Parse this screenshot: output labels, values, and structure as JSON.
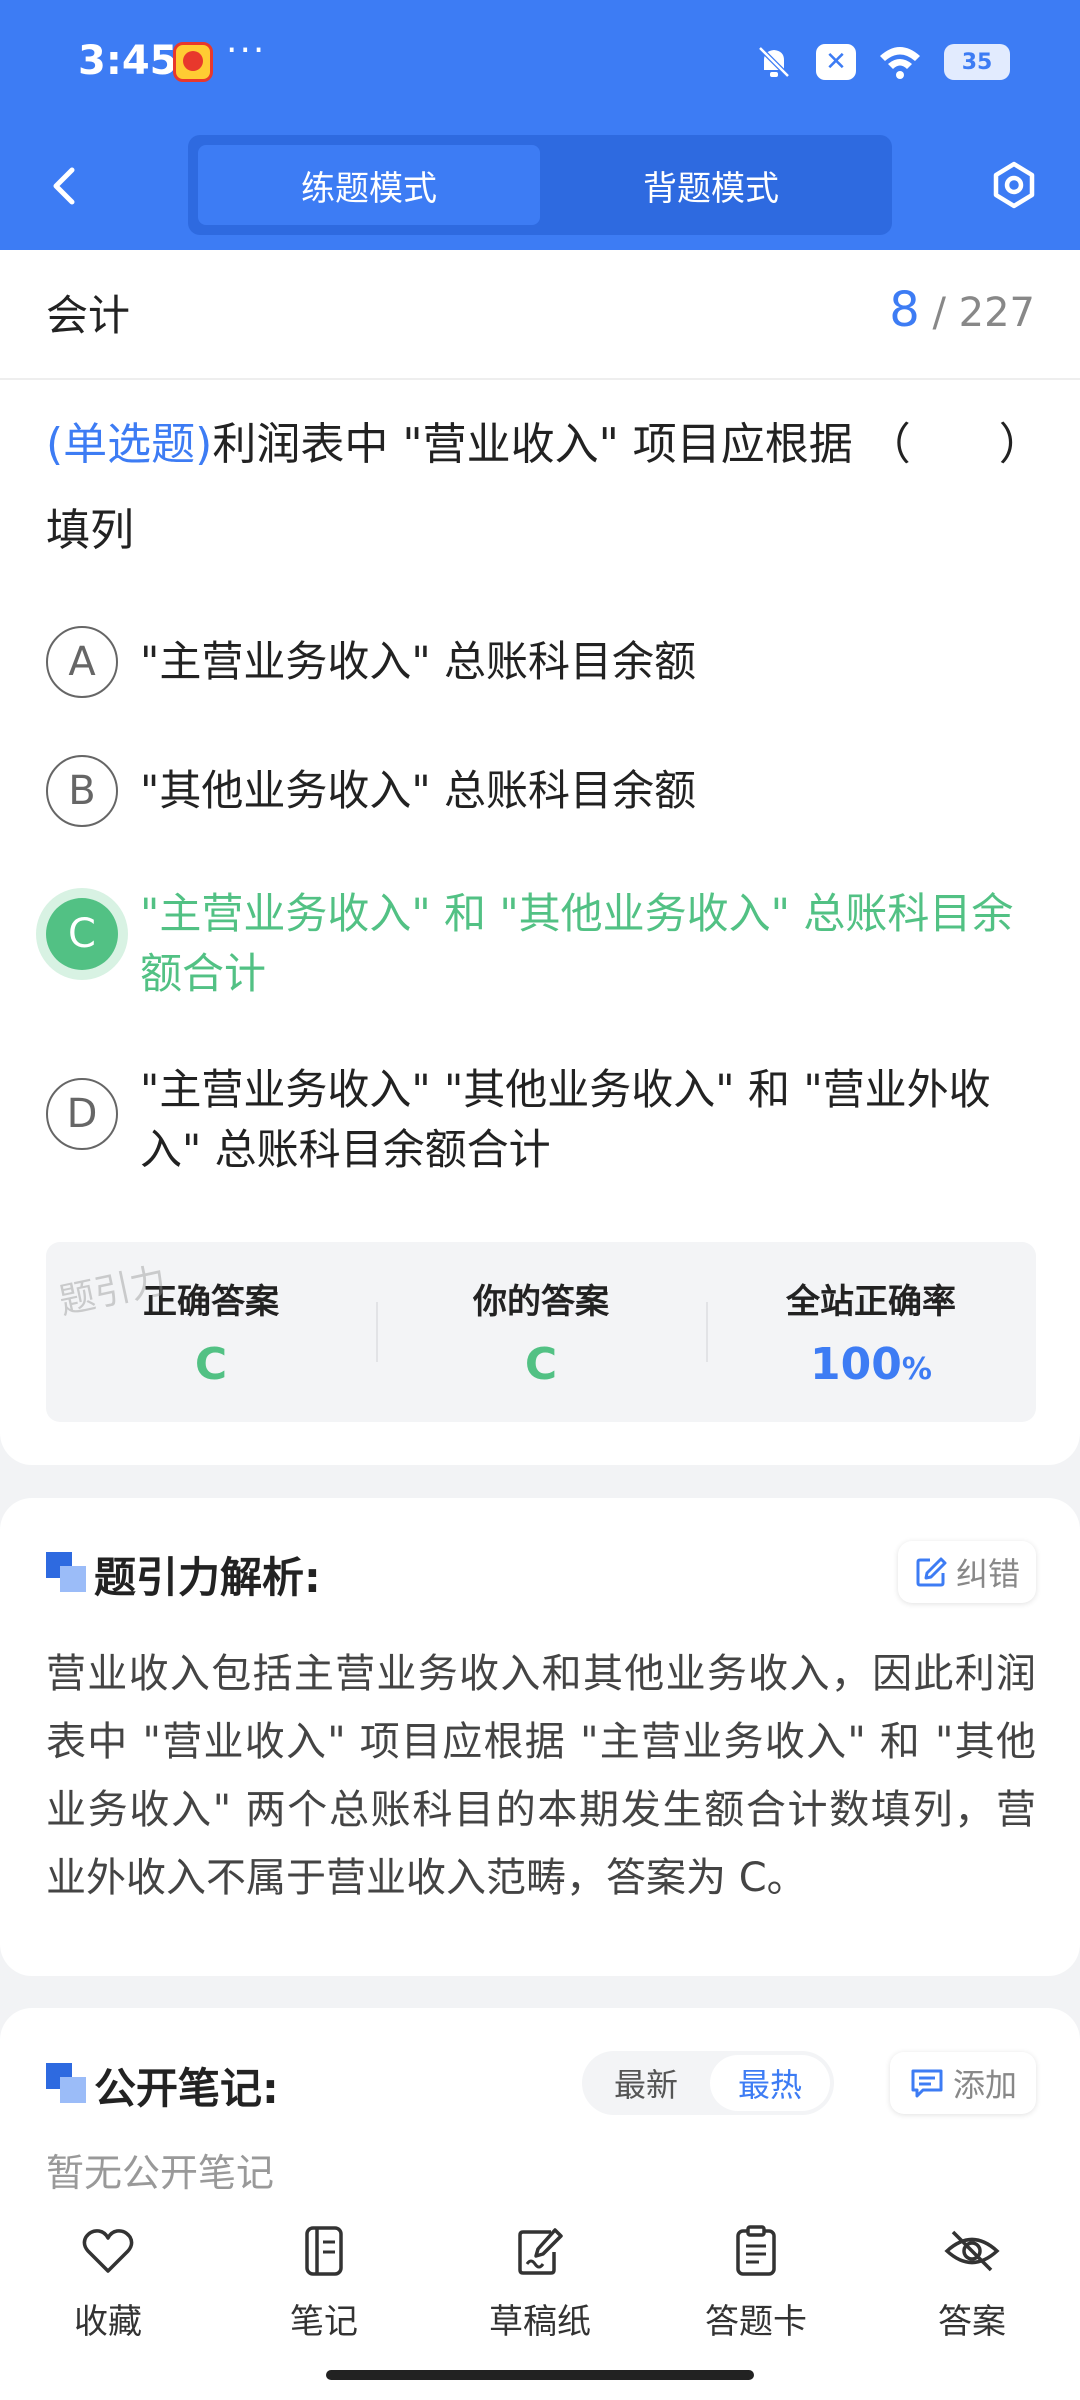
{
  "status_bar": {
    "time": "3:45",
    "battery": "35"
  },
  "header": {
    "tabs": [
      {
        "label": "练题模式",
        "active": true
      },
      {
        "label": "背题模式",
        "active": false
      }
    ]
  },
  "question_header": {
    "subject": "会计",
    "current": "8",
    "total": "/ 227"
  },
  "question": {
    "type": "(单选题)",
    "text": "利润表中 \"营业收入\" 项目应根据 （　　）填列",
    "options": [
      {
        "letter": "A",
        "text": "\"主营业务收入\" 总账科目余额"
      },
      {
        "letter": "B",
        "text": "\"其他业务收入\" 总账科目余额"
      },
      {
        "letter": "C",
        "text": "\"主营业务收入\" 和 \"其他业务收入\" 总账科目余额合计"
      },
      {
        "letter": "D",
        "text": "\"主营业务收入\" \"其他业务收入\" 和 \"营业外收入\" 总账科目余额合计"
      }
    ]
  },
  "answer_summary": {
    "watermark": "题引力",
    "correct_label": "正确答案",
    "correct_value": "C",
    "yours_label": "你的答案",
    "yours_value": "C",
    "rate_label": "全站正确率",
    "rate_value": "100",
    "rate_unit": "%"
  },
  "analysis": {
    "title": "题引力解析:",
    "report_label": "纠错",
    "body": "营业收入包括主营业务收入和其他业务收入，因此利润表中 \"营业收入\" 项目应根据 \"主营业务收入\" 和 \"其他业务收入\" 两个总账科目的本期发生额合计数填列，营业外收入不属于营业收入范畴，答案为 C。"
  },
  "notes": {
    "title": "公开笔记:",
    "sort_latest": "最新",
    "sort_hot": "最热",
    "add_label": "添加",
    "empty": "暂无公开笔记"
  },
  "bottom_nav": [
    {
      "label": "收藏",
      "icon": "heart-icon"
    },
    {
      "label": "笔记",
      "icon": "notebook-icon"
    },
    {
      "label": "草稿纸",
      "icon": "draft-icon"
    },
    {
      "label": "答题卡",
      "icon": "answer-card-icon"
    },
    {
      "label": "答案",
      "icon": "eye-off-icon"
    }
  ],
  "colors": {
    "primary": "#3d7cf4",
    "correct": "#52c184"
  }
}
